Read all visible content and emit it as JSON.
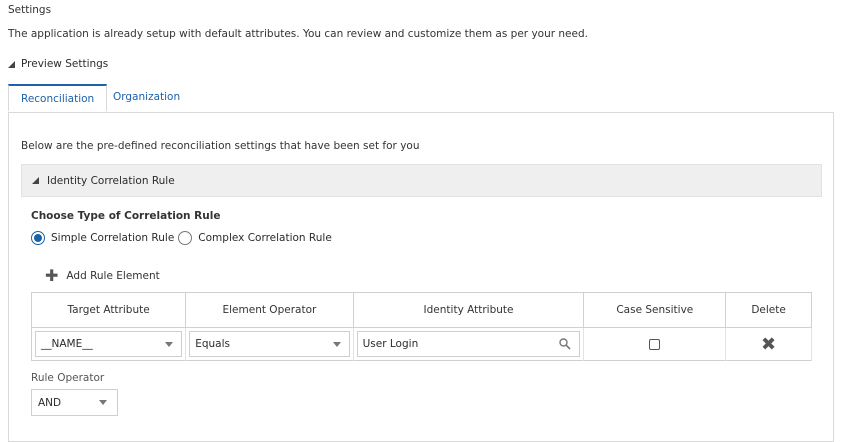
{
  "page": {
    "title": "Settings",
    "description": "The application is already setup with default attributes. You can review and customize them as per your need.",
    "preview_label": "Preview Settings"
  },
  "tabs": [
    {
      "label": "Reconciliation",
      "active": true
    },
    {
      "label": "Organization",
      "active": false
    }
  ],
  "reconciliation": {
    "note": "Below are the pre-defined reconciliation settings that have been set for you",
    "section_title": "Identity Correlation Rule",
    "choose_label": "Choose Type of Correlation Rule",
    "radio_simple": "Simple Correlation Rule",
    "radio_complex": "Complex Correlation Rule",
    "selected_rule_type": "simple",
    "add_rule_label": "Add Rule Element",
    "table": {
      "headers": [
        "Target Attribute",
        "Element Operator",
        "Identity Attribute",
        "Case Sensitive",
        "Delete"
      ],
      "rows": [
        {
          "target": "__NAME__",
          "operator": "Equals",
          "identity": "User Login",
          "case_sensitive": false
        }
      ]
    },
    "rule_operator_label": "Rule Operator",
    "rule_operator_value": "AND"
  },
  "icons": {
    "expand": "triangle-down-icon",
    "add": "plus-icon",
    "search": "search-icon",
    "delete": "close-icon",
    "dropdown": "chevron-down-icon"
  },
  "colors": {
    "accent": "#1b62a8",
    "section_bg": "#efefef"
  }
}
